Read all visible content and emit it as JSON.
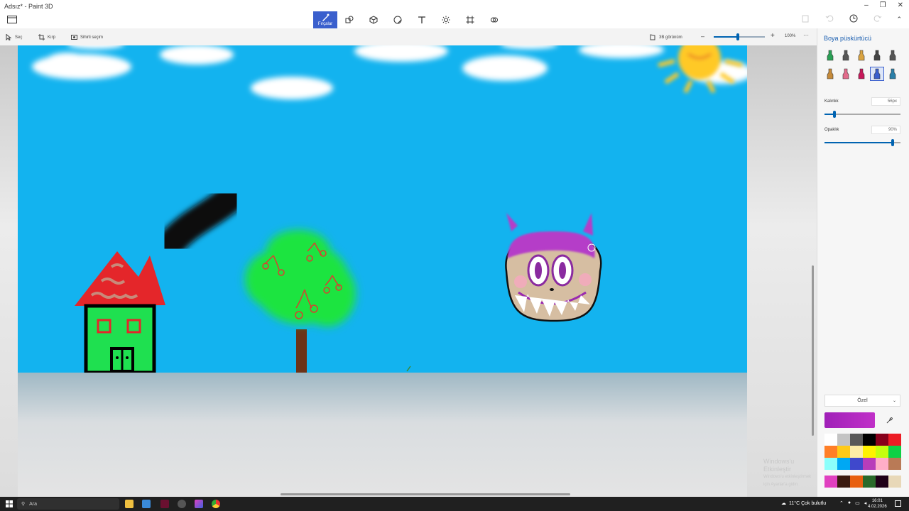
{
  "window": {
    "title": "Adsız* - Paint 3D"
  },
  "main_tools": [
    {
      "name": "brushes",
      "label": "Fırçalar",
      "active": true
    },
    {
      "name": "2d-shapes",
      "label": ""
    },
    {
      "name": "3d-shapes",
      "label": ""
    },
    {
      "name": "stickers",
      "label": ""
    },
    {
      "name": "text",
      "label": ""
    },
    {
      "name": "effects",
      "label": ""
    },
    {
      "name": "canvas",
      "label": ""
    },
    {
      "name": "3d-library",
      "label": ""
    }
  ],
  "subbar": {
    "select_label": "Seç",
    "crop_label": "Kırp",
    "magic_select_label": "Sihirli seçim",
    "view3d_label": "3B görünüm",
    "zoom_value": "100%",
    "zoom_fraction": 0.47
  },
  "panel": {
    "title": "Boya püskürtücü",
    "thickness_label": "Kalınlık",
    "thickness_value": "56px",
    "thickness_fraction": 0.13,
    "opacity_label": "Opaklık",
    "opacity_value": "90%",
    "opacity_fraction": 0.9,
    "color_mode": "Özel",
    "current_color": "#a020b8",
    "brushes": [
      {
        "name": "marker",
        "color": "#2aa055"
      },
      {
        "name": "calligraphy-pen",
        "color": "#555555"
      },
      {
        "name": "oil-brush",
        "color": "#d9a341"
      },
      {
        "name": "watercolor",
        "color": "#444444"
      },
      {
        "name": "pixel-pen",
        "color": "#555555"
      },
      {
        "name": "pencil",
        "color": "#c58a3a"
      },
      {
        "name": "eraser",
        "color": "#e26b8b"
      },
      {
        "name": "crayon",
        "color": "#c8185a"
      },
      {
        "name": "spray-can",
        "color": "#3a5fcd",
        "selected": true
      },
      {
        "name": "fill",
        "color": "#2a7fa8"
      }
    ],
    "palette": [
      "#ffffff",
      "#c3c3c3",
      "#585858",
      "#000000",
      "#88001b",
      "#ec1c24",
      "#ff7f27",
      "#ffca18",
      "#fdeca6",
      "#fff200",
      "#c4ff0e",
      "#0ed145",
      "#8cfffb",
      "#00a8f3",
      "#3f48cc",
      "#b83dba",
      "#ffaec8",
      "#b97a56"
    ],
    "custom_colors": [
      "#e040c0",
      "#3a1a10",
      "#e86010",
      "#2a6a2a",
      "#200018",
      "#e8d8b8"
    ]
  },
  "watermark": {
    "line1": "Windows'u Etkinleştir",
    "line2": "Windows'u etkinleştirmek için Ayarlar'a gidin."
  },
  "taskbar": {
    "search_placeholder": "Ara",
    "weather": "11°C  Çok bulutlu",
    "time": "16:01",
    "date": "4.02.2026"
  }
}
